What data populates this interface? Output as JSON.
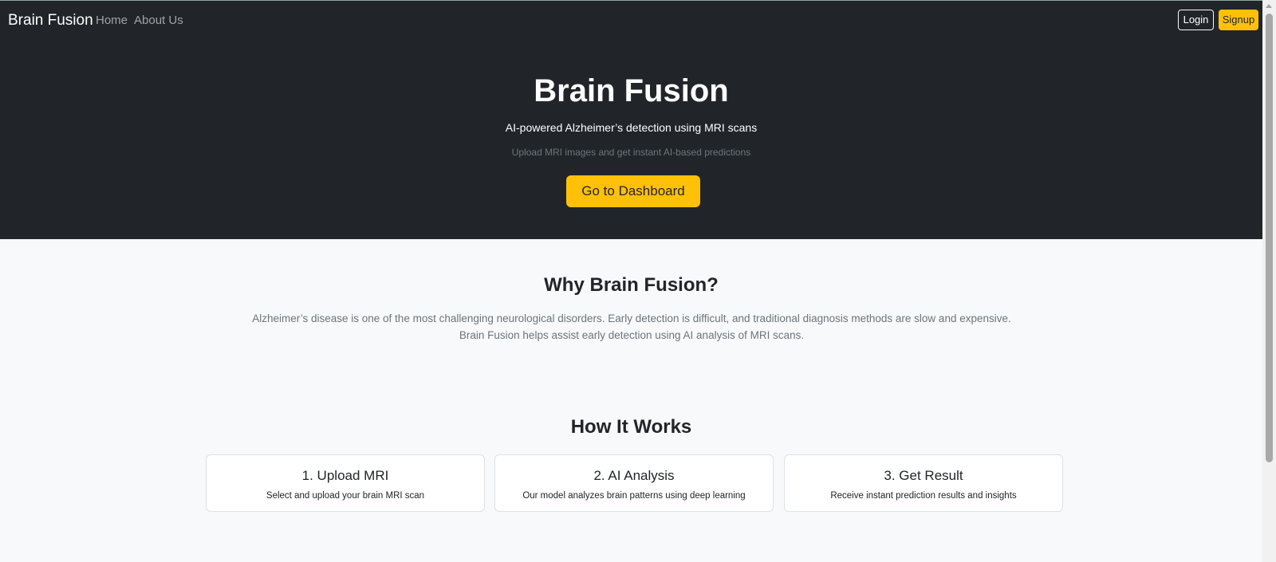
{
  "navbar": {
    "brand": "Brain Fusion",
    "links": [
      {
        "label": "Home"
      },
      {
        "label": "About Us"
      }
    ],
    "login_label": "Login",
    "signup_label": "Signup"
  },
  "hero": {
    "title": "Brain Fusion",
    "subtitle": "AI-powered Alzheimer’s detection using MRI scans",
    "note": "Upload MRI images and get instant AI-based predictions",
    "cta_label": "Go to Dashboard"
  },
  "why": {
    "title": "Why Brain Fusion?",
    "text": "Alzheimer’s disease is one of the most challenging neurological disorders. Early detection is difficult, and traditional diagnosis methods are slow and expensive. Brain Fusion helps assist early detection using AI analysis of MRI scans."
  },
  "how": {
    "title": "How It Works",
    "steps": [
      {
        "title": "1. Upload MRI",
        "text": "Select and upload your brain MRI scan"
      },
      {
        "title": "2. AI Analysis",
        "text": "Our model analyzes brain patterns using deep learning"
      },
      {
        "title": "3. Get Result",
        "text": "Receive instant prediction results and insights"
      }
    ]
  },
  "colors": {
    "dark": "#212529",
    "accent": "#ffc107",
    "light_bg": "#f8f9fa",
    "muted": "#6c757d"
  }
}
